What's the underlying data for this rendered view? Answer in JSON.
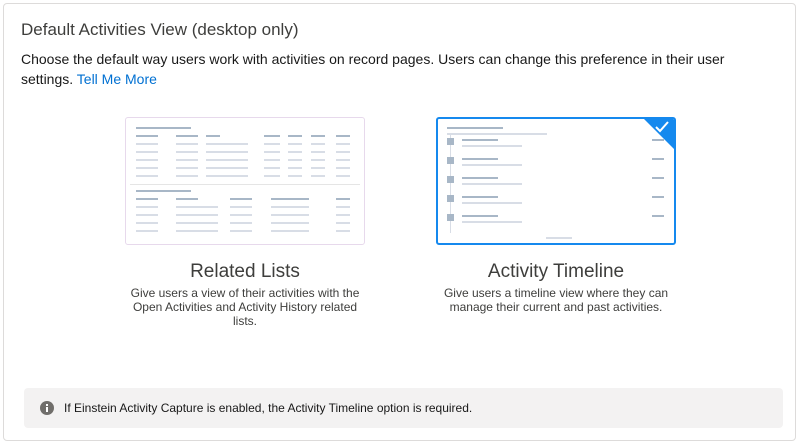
{
  "section": {
    "title": "Default Activities View (desktop only)",
    "description": "Choose the default way users work with activities on record pages. Users can change this preference in their user settings.",
    "link_label": "Tell Me More"
  },
  "options": [
    {
      "name": "Related Lists",
      "description": "Give users a view of their activities with the Open Activities and Activity History related lists.",
      "selected": false
    },
    {
      "name": "Activity Timeline",
      "description": "Give users a timeline view where they can manage their current and past activities.",
      "selected": true
    }
  ],
  "notice": {
    "icon": "info-icon",
    "text": "If Einstein Activity Capture is enabled, the Activity Timeline option is required."
  },
  "colors": {
    "accent": "#1589ee",
    "link": "#0070d2"
  }
}
